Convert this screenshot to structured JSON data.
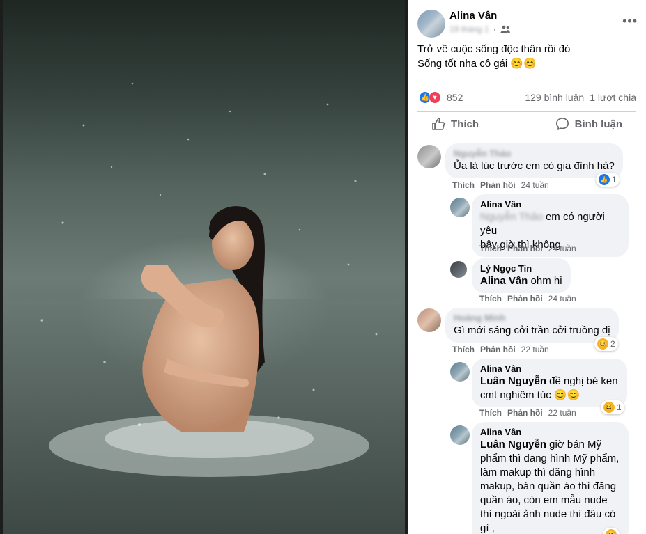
{
  "post": {
    "author": "Alina Vân",
    "meta_time": "19 tháng 1",
    "text_line1": "Trở về cuộc sống độc thân rồi đó",
    "text_line2": "Sống tốt nha cô gái 😊😊",
    "reaction_count": "852",
    "comments_count": "129 bình luận",
    "shares_count": "1 lượt chia",
    "like_label": "Thích",
    "comment_label": "Bình luận"
  },
  "comments": [
    {
      "author": "Nguyễn Thảo",
      "text": "Ủa là lúc trước em có gia đình hả?",
      "like": "Thích",
      "reply": "Phản hồi",
      "time": "24 tuần",
      "reaction_count": "1"
    },
    {
      "author": "Alina Vân",
      "mention": "Nguyễn Thảo",
      "text_line1": " em có người yêu",
      "text_line2": "bây giờ thì không",
      "like": "Thích",
      "reply": "Phản hồi",
      "time": "24 tuần"
    },
    {
      "author": "Lý Ngọc Tin",
      "mention": "Alina Vân",
      "text": " ohm hi",
      "like": "Thích",
      "reply": "Phản hồi",
      "time": "24 tuần"
    },
    {
      "author": "Hoàng Minh",
      "text": "Gì mới sáng cởi trần cởi truồng dị",
      "like": "Thích",
      "reply": "Phản hồi",
      "time": "22 tuần",
      "reaction_count": "2"
    },
    {
      "author": "Alina Vân",
      "mention": "Luân Nguyễn",
      "text_line1": " đề nghị bé ken",
      "text_line2": "cmt nghiêm túc 😊😊",
      "like": "Thích",
      "reply": "Phản hồi",
      "time": "22 tuần",
      "reaction_count": "1"
    },
    {
      "author": "Alina Vân",
      "mention": "Luân Nguyễn",
      "lines": [
        " giờ bán Mỹ",
        "phẩm thì đang hình Mỹ phẩm,",
        "làm makup thì đăng hình",
        "makup, bán quần áo thì đăng",
        "quần áo, còn em mẫu nude",
        "thì ngoài ảnh nude thì đâu có",
        "gì ,"
      ]
    }
  ],
  "colors": {
    "accent": "#1877f2",
    "love": "#f33e58",
    "bubble": "#f0f2f5",
    "muted": "#65676b"
  }
}
